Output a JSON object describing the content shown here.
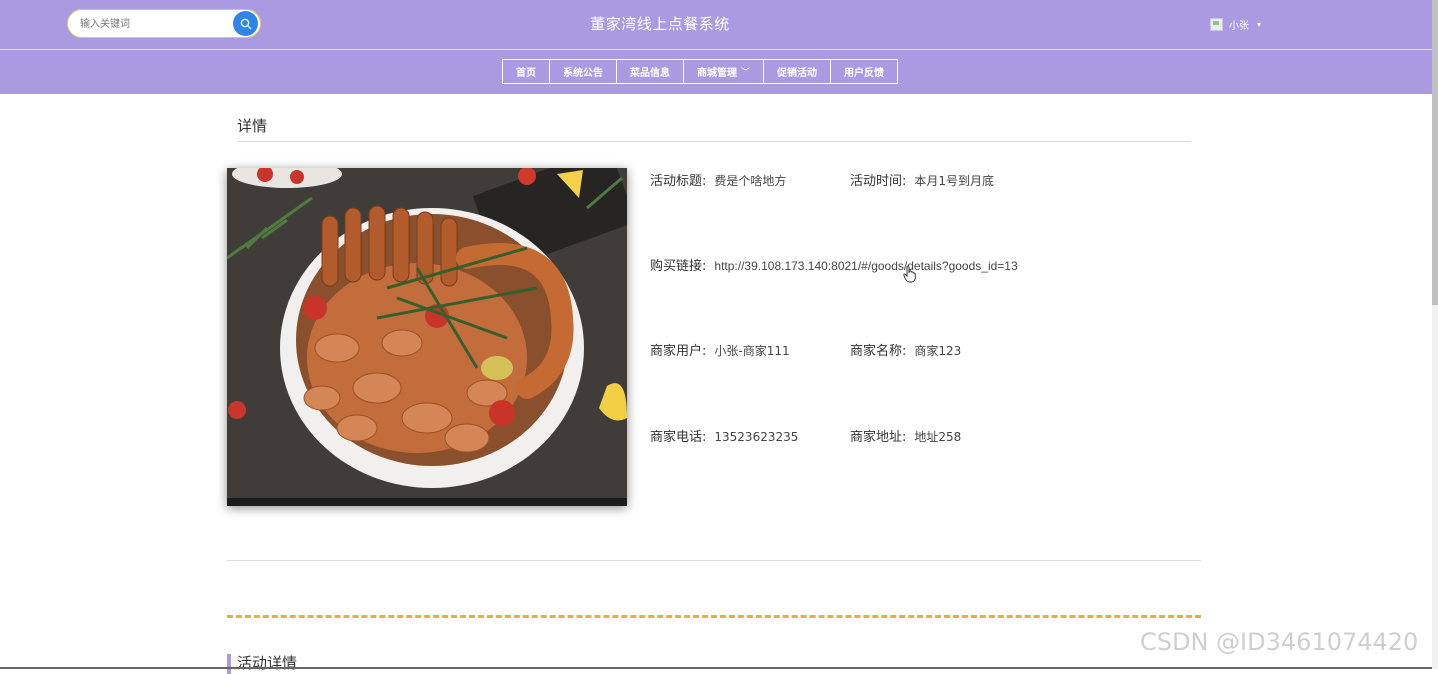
{
  "header": {
    "search_placeholder": "输入关键词",
    "site_title": "董家湾线上点餐系统",
    "username": "小张",
    "bg_color": "#a99ae2"
  },
  "nav": {
    "items": [
      {
        "label": "首页"
      },
      {
        "label": "系统公告"
      },
      {
        "label": "菜品信息"
      },
      {
        "label": "商城管理",
        "has_dropdown": true
      },
      {
        "label": "促销活动"
      },
      {
        "label": "用户反馈"
      }
    ]
  },
  "detail": {
    "section_title": "详情",
    "fields": {
      "activity_title": {
        "label": "活动标题:",
        "value": "费是个啥地方"
      },
      "activity_time": {
        "label": "活动时间:",
        "value": "本月1号到月底"
      },
      "purchase_link": {
        "label": "购买链接:",
        "value": "http://39.108.173.140:8021/#/goods/details?goods_id=13"
      },
      "merchant_user": {
        "label": "商家用户:",
        "value": "小张-商家111"
      },
      "merchant_name": {
        "label": "商家名称:",
        "value": "商家123"
      },
      "merchant_phone": {
        "label": "商家电话:",
        "value": "13523623235"
      },
      "merchant_address": {
        "label": "商家地址:",
        "value": "地址258"
      }
    },
    "activity_details_title": "活动详情"
  },
  "watermark": "CSDN @ID3461074420",
  "colors": {
    "accent": "#a99ae2",
    "search_button": "#2f86e6",
    "dash_line": "#efac3a"
  }
}
